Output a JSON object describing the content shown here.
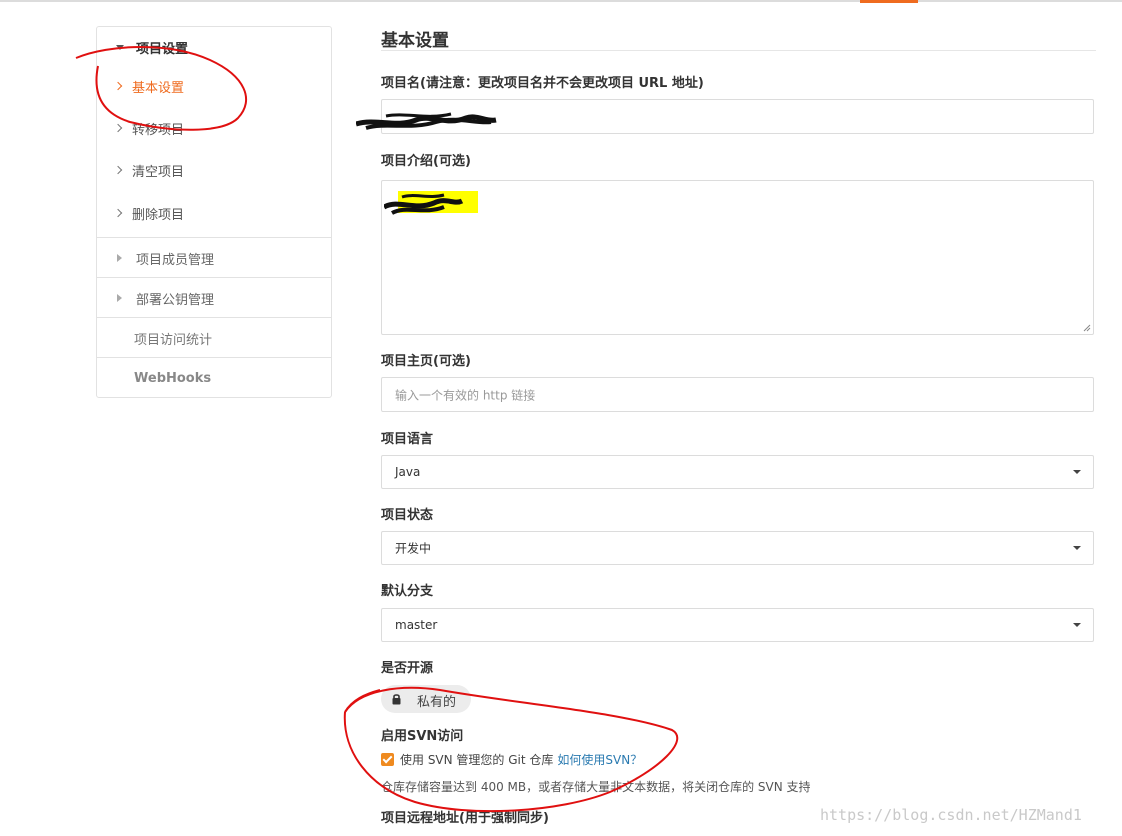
{
  "sidebar": {
    "header": "项目设置",
    "items": [
      {
        "label": "基本设置",
        "active": true
      },
      {
        "label": "转移项目",
        "active": false
      },
      {
        "label": "清空项目",
        "active": false
      },
      {
        "label": "删除项目",
        "active": false
      }
    ],
    "groups": [
      {
        "label": "项目成员管理"
      },
      {
        "label": "部署公钥管理"
      },
      {
        "label": "项目访问统计"
      },
      {
        "label": "WebHooks"
      }
    ]
  },
  "main": {
    "title": "基本设置",
    "project_name": {
      "label": "项目名(请注意：更改项目名并不会更改项目 URL 地址)",
      "value": ""
    },
    "description": {
      "label": "项目介绍(可选)",
      "value": ""
    },
    "homepage": {
      "label": "项目主页(可选)",
      "placeholder": "输入一个有效的 http 链接"
    },
    "language": {
      "label": "项目语言",
      "value": "Java"
    },
    "status": {
      "label": "项目状态",
      "value": "开发中"
    },
    "default_branch": {
      "label": "默认分支",
      "value": "master"
    },
    "open_source": {
      "label": "是否开源",
      "value": "私有的"
    },
    "svn": {
      "label": "启用SVN访问",
      "checkbox_text": "使用 SVN 管理您的 Git 仓库",
      "link_text": "如何使用SVN？",
      "checked": true,
      "note": "仓库存储容量达到 400 MB，或者存储大量非文本数据，将关闭仓库的 SVN 支持"
    },
    "remote_url": {
      "label": "项目远程地址(用于强制同步)"
    }
  },
  "watermark": "https://blog.csdn.net/HZMand1",
  "colors": {
    "accent": "#ef6b1f",
    "link": "#2a7ab0",
    "annotation": "#e01010",
    "highlight": "#ffff00"
  }
}
